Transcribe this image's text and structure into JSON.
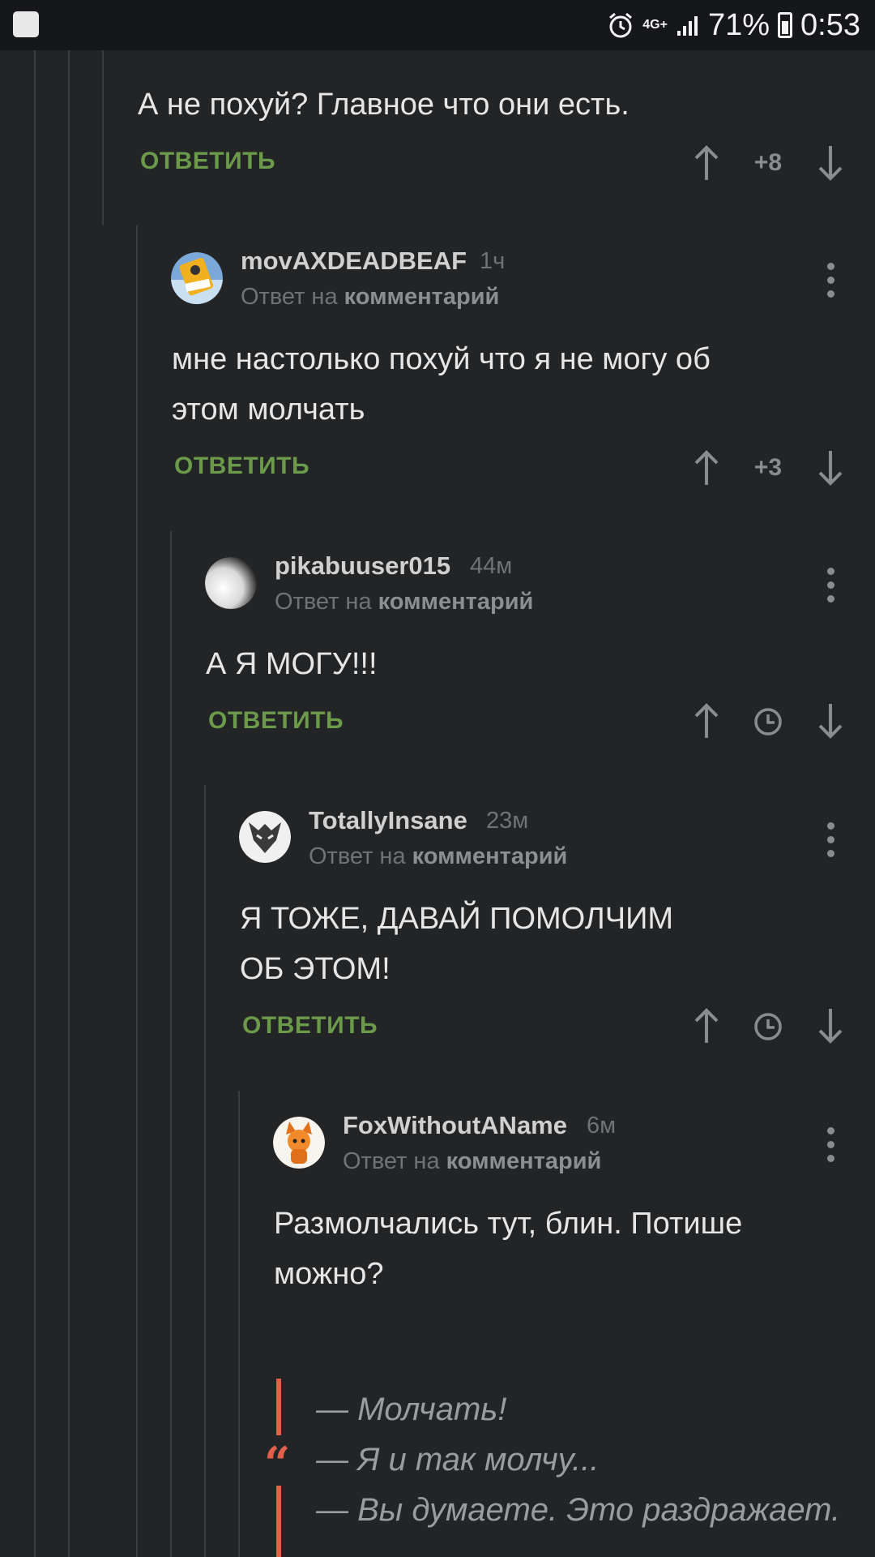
{
  "status_bar": {
    "network": "4G+",
    "battery": "71%",
    "time": "0:53"
  },
  "top_comment": {
    "text": "А не похуй? Главное что они есть.",
    "reply_label": "ОТВЕТИТЬ",
    "score": "+8"
  },
  "comments": [
    {
      "author": "movAXDEADBEAF",
      "time": "1ч",
      "reply_prefix": "Ответ на",
      "reply_target": "комментарий",
      "text_lines": [
        "мне настолько похуй что я не могу об",
        "этом молчать"
      ],
      "reply_label": "ОТВЕТИТЬ",
      "score": "+3"
    },
    {
      "author": "pikabuuser015",
      "time": "44м",
      "reply_prefix": "Ответ на",
      "reply_target": "комментарий",
      "text_lines": [
        "А Я МОГУ!!!"
      ],
      "reply_label": "ОТВЕТИТЬ",
      "score_icon": "clock-icon"
    },
    {
      "author": "TotallyInsane",
      "time": "23м",
      "reply_prefix": "Ответ на",
      "reply_target": "комментарий",
      "text_lines": [
        "Я ТОЖЕ, ДАВАЙ ПОМОЛЧИМ",
        "ОБ ЭТОМ!"
      ],
      "reply_label": "ОТВЕТИТЬ",
      "score_icon": "clock-icon"
    },
    {
      "author": "FoxWithoutAName",
      "time": "6м",
      "reply_prefix": "Ответ на",
      "reply_target": "комментарий",
      "text_lines": [
        "Размолчались тут, блин. Потише",
        "можно?"
      ],
      "quote_lines": [
        "— Молчать!",
        "— Я и так молчу...",
        "— Вы думаете. Это раздражает."
      ]
    }
  ],
  "colors": {
    "background": "#222426",
    "accent_green": "#6a9a4a",
    "quote_accent": "#e0604a"
  }
}
